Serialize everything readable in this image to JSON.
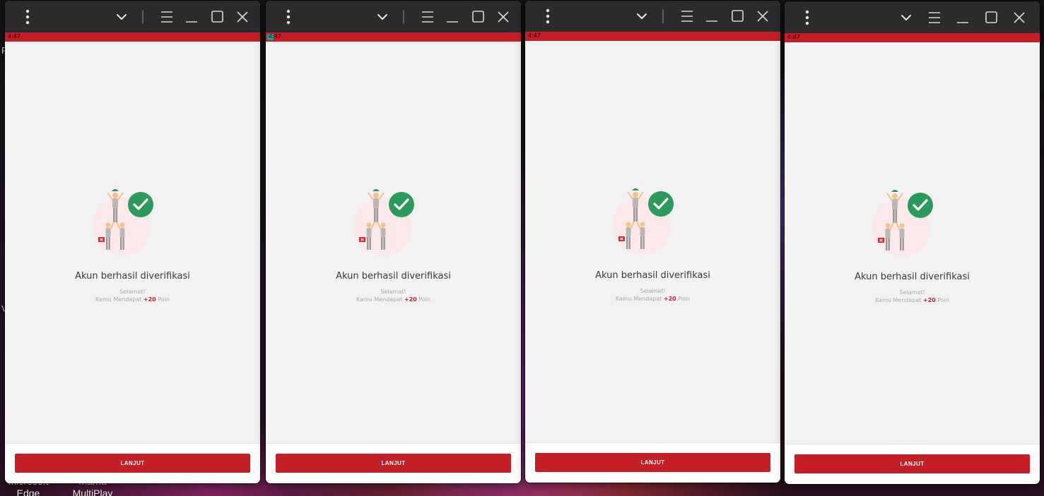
{
  "desktop": {
    "icons": [
      {
        "label_line1": "Microsoft",
        "label_line2": "Edge"
      },
      {
        "label_line1": "Mama",
        "label_line2": "MultiPlay"
      }
    ],
    "stray_chars": [
      "F",
      "V"
    ]
  },
  "accent_color": "#c41f26",
  "check_color": "#2b9a5a",
  "windows": [
    {
      "status_time": "4:47",
      "title": "Akun berhasil diverifikasi",
      "congrats": "Selamat!",
      "points_prefix": "Kamu Mendapat",
      "points_value": "+20",
      "points_suffix": "Poin",
      "button_label": "LANJUT"
    },
    {
      "status_time": "4:47",
      "title": "Akun berhasil diverifikasi",
      "congrats": "Selamat!",
      "points_prefix": "Kamu Mendapat",
      "points_value": "+20",
      "points_suffix": "Poin",
      "button_label": "LANJUT"
    },
    {
      "status_time": "4:47",
      "title": "Akun berhasil diverifikasi",
      "congrats": "Selamat!",
      "points_prefix": "Kamu Mendapat",
      "points_value": "+20",
      "points_suffix": "Poin",
      "button_label": "LANJUT"
    },
    {
      "status_time": "4:47",
      "title": "Akun berhasil diverifikasi",
      "congrats": "Selamat!",
      "points_prefix": "Kamu Mendapat",
      "points_value": "+20",
      "points_suffix": "Poin",
      "button_label": "LANJUT"
    }
  ]
}
